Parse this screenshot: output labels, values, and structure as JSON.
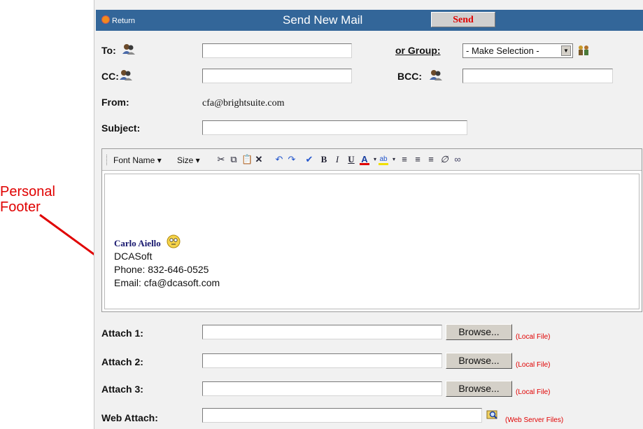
{
  "annotation": {
    "line1": "Personal",
    "line2": "Footer"
  },
  "header": {
    "return_label": "Return",
    "title": "Send New Mail",
    "send_label": "Send"
  },
  "form": {
    "to_label": "To:",
    "group_label": "or Group:",
    "group_select": "- Make Selection -",
    "cc_label": "CC:",
    "bcc_label": "BCC:",
    "from_label": "From:",
    "from_value": "cfa@brightsuite.com",
    "subject_label": "Subject:"
  },
  "toolbar": {
    "font_name": "Font Name",
    "size": "Size"
  },
  "signature": {
    "name": "Carlo Aiello",
    "company": "DCASoft",
    "phone": "Phone: 832-646-0525",
    "email": "Email: cfa@dcasoft.com"
  },
  "attachments": [
    {
      "label": "Attach 1:",
      "button": "Browse...",
      "note": "(Local File)"
    },
    {
      "label": "Attach 2:",
      "button": "Browse...",
      "note": "(Local File)"
    },
    {
      "label": "Attach 3:",
      "button": "Browse...",
      "note": "(Local File)"
    }
  ],
  "web_attach": {
    "label": "Web Attach:",
    "note": "(Web Server Files)"
  },
  "colors": {
    "header_bg": "#336699",
    "annotation": "#e00000",
    "panel_bg": "#f1f1f1"
  }
}
